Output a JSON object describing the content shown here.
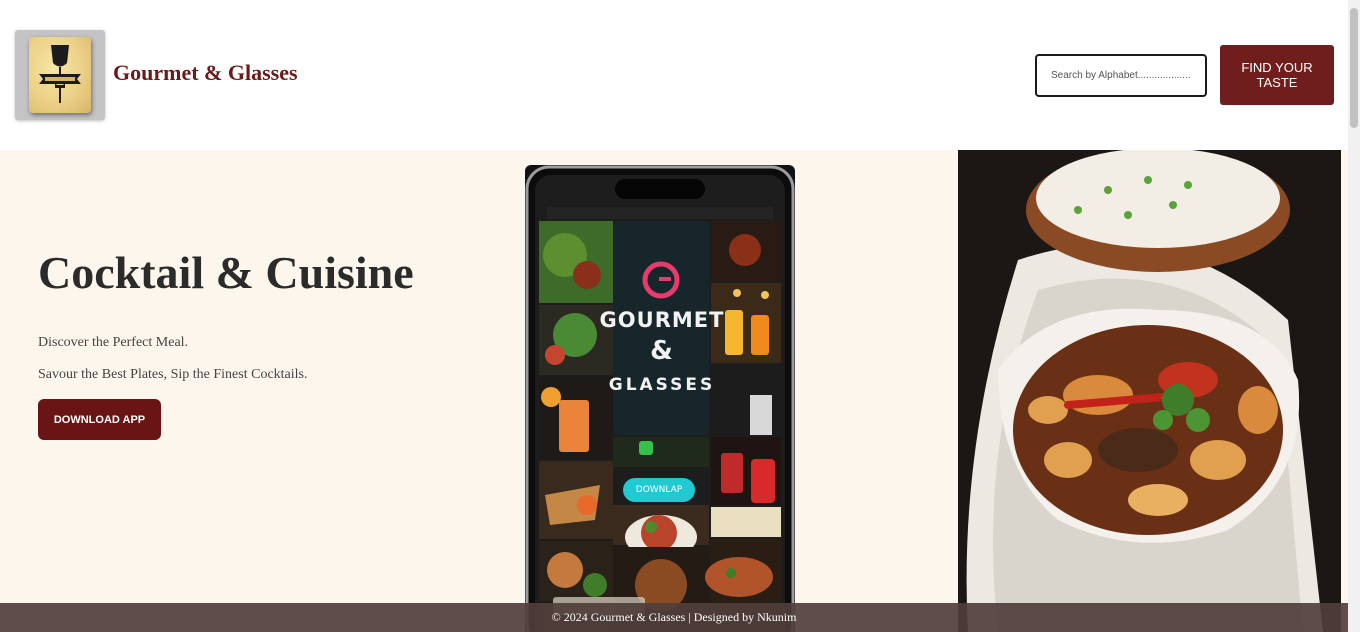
{
  "header": {
    "brand": "Gourmet & Glasses",
    "search_placeholder": "Search by Alphabet...................",
    "find_button": "FIND YOUR TASTE"
  },
  "hero": {
    "title": "Cocktail & Cuisine",
    "tagline_1": "Discover the Perfect Meal.",
    "tagline_2": "Savour the Best Plates, Sip the Finest Cocktails.",
    "download_button": "DOWNLOAD APP"
  },
  "phone_mockup": {
    "line_1": "GOURMET",
    "line_2": "&",
    "line_3": "GLASSES",
    "button": "DOWNLAP"
  },
  "footer": {
    "text": "© 2024 Gourmet & Glasses | Designed by Nkunim"
  },
  "colors": {
    "brand": "#6b1a1a",
    "button": "#6f1d1d",
    "hero_bg": "#fcf6ec",
    "footer_bg": "#503e3c"
  },
  "icons": [
    "logo-wine-glass-fork-icon"
  ]
}
